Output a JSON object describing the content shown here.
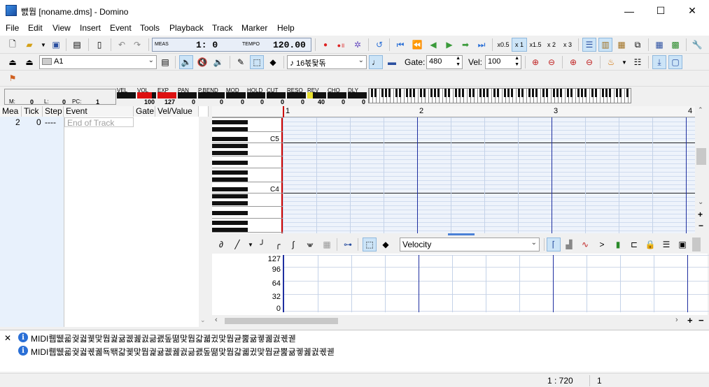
{
  "window": {
    "title": "뺈뭡 [noname.dms] - Domino",
    "minimize": "—",
    "maximize": "☐",
    "close": "✕"
  },
  "menu": [
    "File",
    "Edit",
    "View",
    "Insert",
    "Event",
    "Tools",
    "Playback",
    "Track",
    "Marker",
    "Help"
  ],
  "transport": {
    "meas_label": "MEAS",
    "meas_value": "1:  0",
    "tempo_label": "TEMPO",
    "tempo_value": "120.00",
    "speeds": [
      "x0.5",
      "x 1",
      "x1.5",
      "x 2",
      "x 3"
    ],
    "active_speed": "x 1"
  },
  "toolbar2": {
    "track_name": "A1",
    "note_length": "16볷돷돆",
    "gate_label": "Gate:",
    "gate_value": "480",
    "vel_label": "Vel:",
    "vel_value": "100"
  },
  "meters": {
    "labels": [
      "VEL",
      "VOL",
      "EXP",
      "PAN",
      "P.BEND",
      "MOD",
      "HOLD",
      "CUT",
      "RESO",
      "REV",
      "CHO",
      "DLY"
    ],
    "values": [
      "",
      "100",
      "127",
      "0",
      "0",
      "0",
      "0",
      "0",
      "0",
      "40",
      "0",
      "0"
    ],
    "m_label": "M:",
    "m_value": "0",
    "l_label": "L:",
    "l_value": "0",
    "pc_label": "PC:",
    "pc_value": "1"
  },
  "event_list": {
    "columns": [
      "Mea",
      "Tick",
      "Step",
      "Event",
      "Gate",
      "Vel/Value"
    ],
    "rows": [
      {
        "mea": "2",
        "tick": "0",
        "step": "----",
        "event": "End of Track",
        "gate": "",
        "value": ""
      }
    ]
  },
  "pianoroll": {
    "measures": [
      "1",
      "2",
      "3",
      "4"
    ],
    "octave_labels": [
      "C5",
      "C4"
    ]
  },
  "controller": {
    "type": "Velocity",
    "y_labels": [
      "127",
      "96",
      "64",
      "32",
      "0"
    ]
  },
  "log": [
    "MIDI뤱뛦굛궟궓궻맟뭡궕귦궶궲궔긂괤돞뗢맟뭡갋궯귔맟뭡귣뿚귦궿궲궔궧궫",
    "MIDI뤱뛦굛궟궓궧궲됵뙊갋궻맟뭡궕귦궶궲궔긂괤돞뗢맟뭡갋궯귔맟뭡귣뿚귦궿궲궔궧궫"
  ],
  "status": {
    "position": "1 : 720",
    "value": "1"
  }
}
